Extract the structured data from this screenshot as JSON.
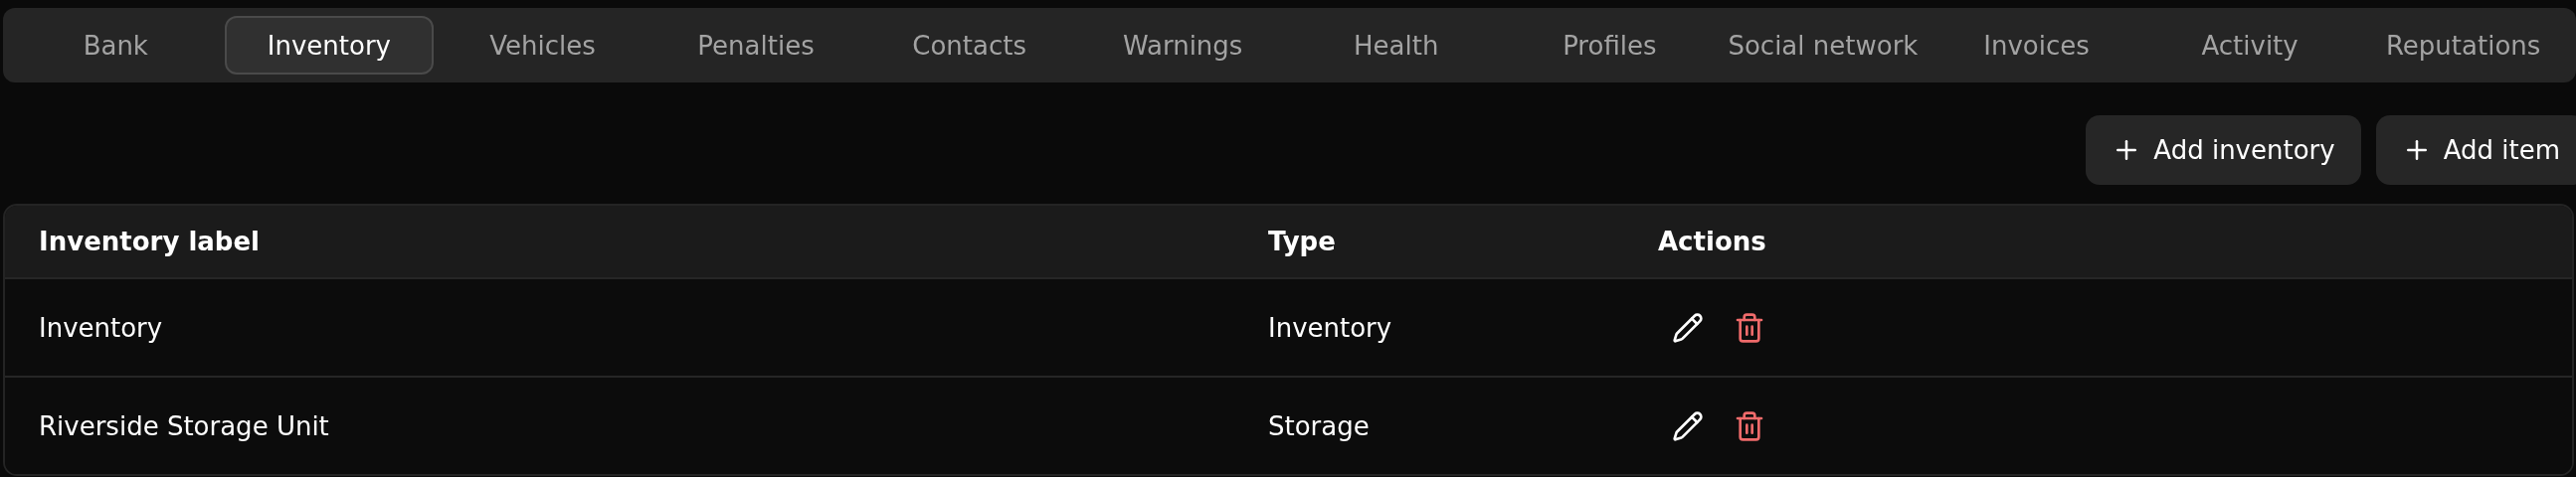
{
  "tabs": [
    {
      "label": "Bank",
      "selected": false
    },
    {
      "label": "Inventory",
      "selected": true
    },
    {
      "label": "Vehicles",
      "selected": false
    },
    {
      "label": "Penalties",
      "selected": false
    },
    {
      "label": "Contacts",
      "selected": false
    },
    {
      "label": "Warnings",
      "selected": false
    },
    {
      "label": "Health",
      "selected": false
    },
    {
      "label": "Profiles",
      "selected": false
    },
    {
      "label": "Social network",
      "selected": false
    },
    {
      "label": "Invoices",
      "selected": false
    },
    {
      "label": "Activity",
      "selected": false
    },
    {
      "label": "Reputations",
      "selected": false
    }
  ],
  "buttons": [
    "Add inventory",
    "Add item"
  ],
  "table": {
    "columns": [
      "Inventory label",
      "Type",
      "Actions"
    ],
    "rows": [
      {
        "label": "Inventory",
        "type": "Inventory"
      },
      {
        "label": "Riverside Storage Unit",
        "type": "Storage"
      }
    ]
  }
}
